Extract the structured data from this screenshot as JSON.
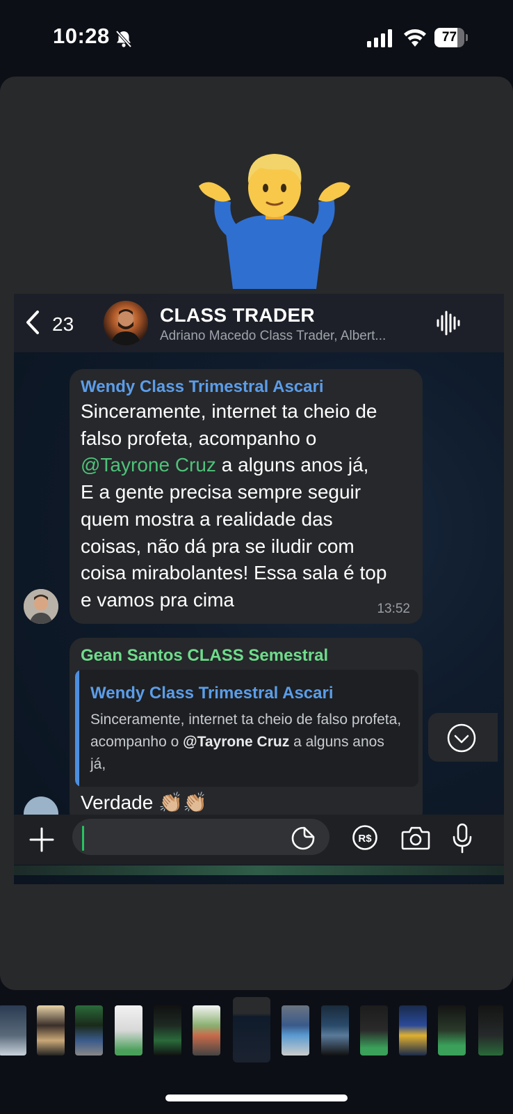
{
  "status_bar": {
    "time": "10:28",
    "battery_percent": "77",
    "battery_level": 0.77,
    "icons": [
      "bell-slash-icon",
      "signal-icon",
      "wifi-icon",
      "battery-icon"
    ]
  },
  "emoji": "person-shrugging",
  "chat_header": {
    "back_count": "23",
    "title": "CLASS TRADER",
    "subtitle": "Adriano Macedo Class Trader, Albert..."
  },
  "messages": [
    {
      "sender": "Wendy Class Trimestral Ascari",
      "sender_color": "#5c9de8",
      "text_before": "Sinceramente, internet ta cheio de\nfalso profeta, acompanho o\n",
      "mention": "@Tayrone Cruz",
      "text_after": " a alguns anos já,\nE a gente precisa sempre seguir\nquem mostra a realidade das\ncoisas, não dá pra se iludir com\ncoisa mirabolantes! Essa sala é top\ne vamos pra cima",
      "time": "13:52"
    },
    {
      "sender": "Gean Santos CLASS Semestral",
      "sender_color": "#6fdc8c",
      "quote": {
        "sender": "Wendy Class Trimestral Ascari",
        "text_before": "Sinceramente, internet ta cheio de falso profeta, acompanho o ",
        "mention": "@Tayrone Cruz",
        "text_after": " a alguns anos já,"
      },
      "partial_text": "Verdade 👏🏼👏🏼"
    }
  ],
  "colors": {
    "accent_green": "#25c45f",
    "mention_green": "#4fc27a",
    "bubble": "#26282b",
    "card": "#28292b"
  }
}
